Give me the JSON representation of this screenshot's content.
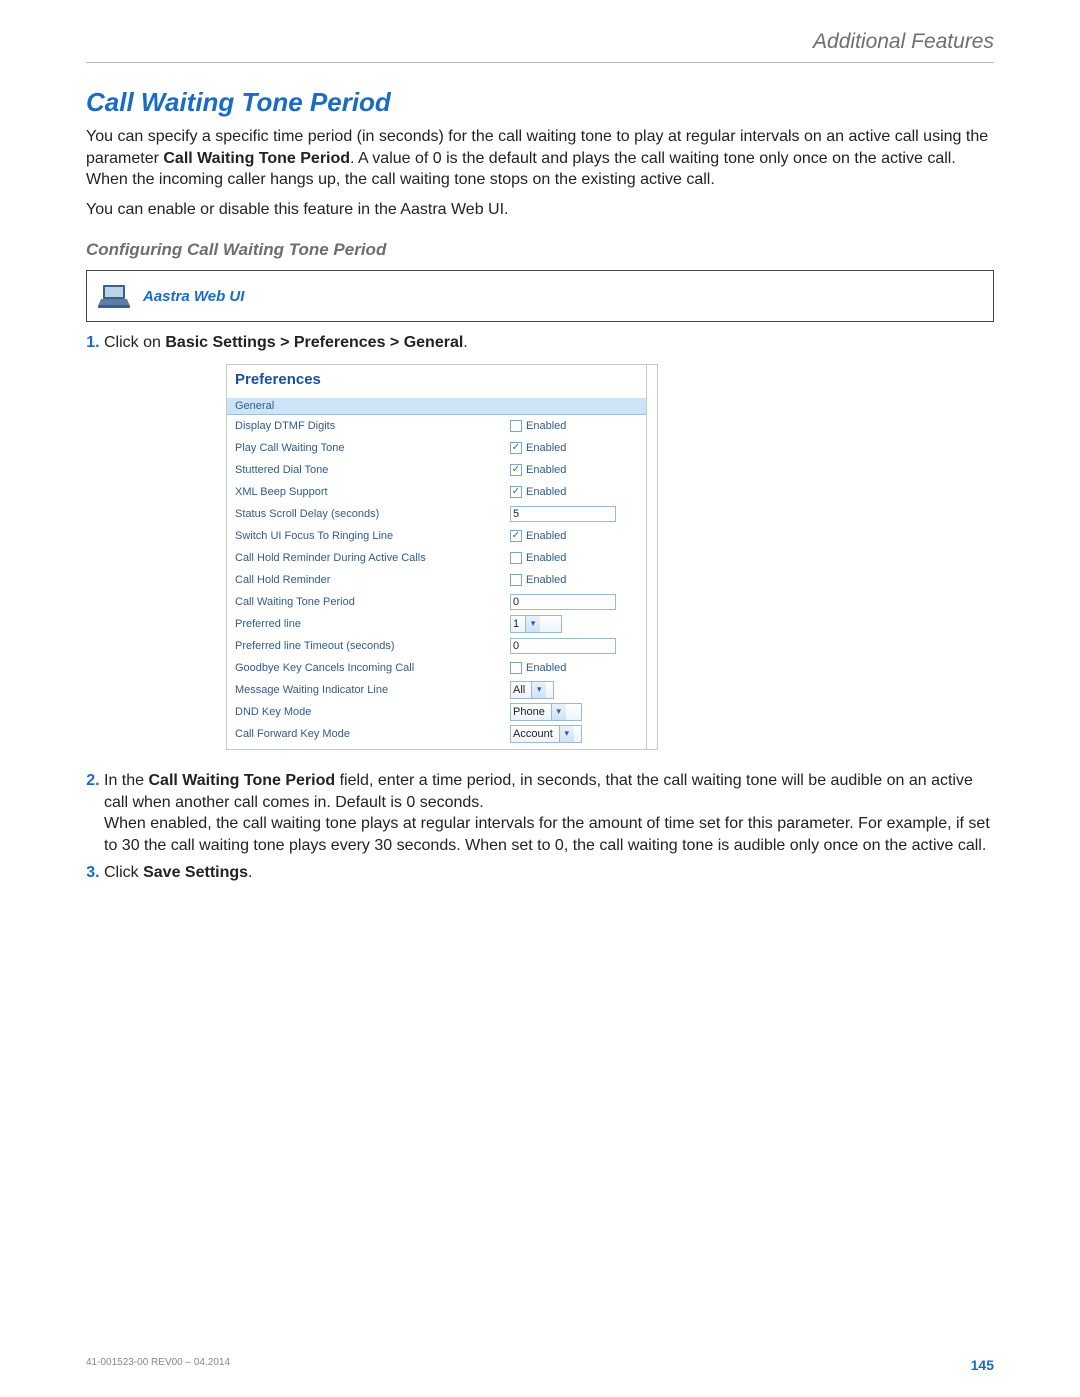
{
  "header": {
    "section_title": "Additional Features"
  },
  "title": "Call Waiting Tone Period",
  "intro": {
    "p1_a": "You can specify a specific time period (in seconds) for the call waiting tone to play at regular intervals on an active call using the parameter ",
    "p1_bold": "Call Waiting Tone Period",
    "p1_b": ". A value of 0 is the default and plays the call waiting tone only once on the active call. When the incoming caller hangs up, the call waiting tone stops on the existing active call.",
    "p2": "You can enable or disable this feature in the Aastra Web UI."
  },
  "subhead": "Configuring Call Waiting Tone Period",
  "callout": {
    "label": "Aastra Web UI"
  },
  "steps": {
    "s1_a": "Click on ",
    "s1_bold": "Basic Settings > Preferences > General",
    "s1_b": ".",
    "s2_a": "In the ",
    "s2_bold": "Call Waiting Tone Period",
    "s2_b": " field, enter a time period, in seconds, that the call waiting tone will be audible on an active call when another call comes in. Default is 0 seconds.",
    "s2_c": "When enabled, the call waiting tone plays at regular intervals for the amount of time set for this parameter. For example, if set to 30 the call waiting tone plays every 30 seconds. When set to 0, the call waiting tone is audible only once on the active call.",
    "s3_a": "Click ",
    "s3_bold": "Save Settings",
    "s3_b": "."
  },
  "screenshot": {
    "heading": "Preferences",
    "section": "General",
    "enabled_label": "Enabled",
    "rows": {
      "dtmf": {
        "label": "Display DTMF Digits",
        "checked": false
      },
      "playcw": {
        "label": "Play Call Waiting Tone",
        "checked": true
      },
      "stuttered": {
        "label": "Stuttered Dial Tone",
        "checked": true
      },
      "xmlbeep": {
        "label": "XML Beep Support",
        "checked": true
      },
      "scrolldelay": {
        "label": "Status Scroll Delay (seconds)",
        "value": "5"
      },
      "switchui": {
        "label": "Switch UI Focus To Ringing Line",
        "checked": true
      },
      "holdactive": {
        "label": "Call Hold Reminder During Active Calls",
        "checked": false
      },
      "holdrem": {
        "label": "Call Hold Reminder",
        "checked": false
      },
      "cwperiod": {
        "label": "Call Waiting Tone Period",
        "value": "0"
      },
      "prefline": {
        "label": "Preferred line",
        "value": "1"
      },
      "preftimeout": {
        "label": "Preferred line Timeout (seconds)",
        "value": "0"
      },
      "goodbye": {
        "label": "Goodbye Key Cancels Incoming Call",
        "checked": false
      },
      "mwi": {
        "label": "Message Waiting Indicator Line",
        "value": "All"
      },
      "dndmode": {
        "label": "DND Key Mode",
        "value": "Phone"
      },
      "cfwdmode": {
        "label": "Call Forward Key Mode",
        "value": "Account"
      }
    }
  },
  "footer": {
    "docrev": "41-001523-00 REV00 – 04.2014",
    "page": "145"
  }
}
